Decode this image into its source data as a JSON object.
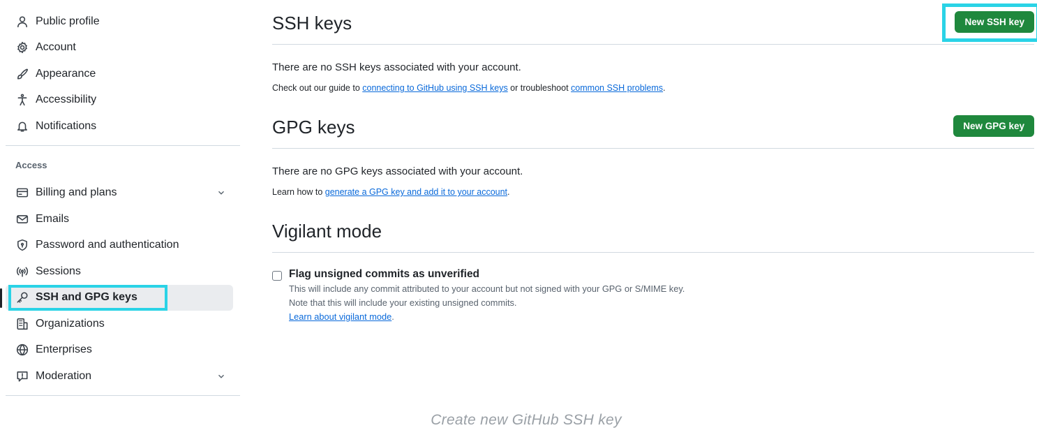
{
  "sidebar": {
    "top_items": [
      {
        "label": "Public profile",
        "icon": "person-icon"
      },
      {
        "label": "Account",
        "icon": "gear-icon"
      },
      {
        "label": "Appearance",
        "icon": "paintbrush-icon"
      },
      {
        "label": "Accessibility",
        "icon": "accessibility-icon"
      },
      {
        "label": "Notifications",
        "icon": "bell-icon"
      }
    ],
    "access_label": "Access",
    "access_items": [
      {
        "label": "Billing and plans",
        "icon": "credit-card-icon"
      },
      {
        "label": "Emails",
        "icon": "mail-icon"
      },
      {
        "label": "Password and authentication",
        "icon": "shield-lock-icon"
      },
      {
        "label": "Sessions",
        "icon": "broadcast-icon"
      },
      {
        "label": "SSH and GPG keys",
        "icon": "key-icon"
      },
      {
        "label": "Organizations",
        "icon": "organization-icon"
      },
      {
        "label": "Enterprises",
        "icon": "globe-icon"
      },
      {
        "label": "Moderation",
        "icon": "report-icon"
      }
    ]
  },
  "ssh": {
    "title": "SSH keys",
    "button": "New SSH key",
    "empty": "There are no SSH keys associated with your account.",
    "help_prefix": "Check out our guide to ",
    "help_link1": "connecting to GitHub using SSH keys",
    "help_middle": " or troubleshoot ",
    "help_link2": "common SSH problems",
    "help_suffix": "."
  },
  "gpg": {
    "title": "GPG keys",
    "button": "New GPG key",
    "empty": "There are no GPG keys associated with your account.",
    "help_prefix": "Learn how to ",
    "help_link": "generate a GPG key and add it to your account",
    "help_suffix": "."
  },
  "vigilant": {
    "title": "Vigilant mode",
    "checkbox_label": "Flag unsigned commits as unverified",
    "checked": false,
    "desc1": "This will include any commit attributed to your account but not signed with your GPG or S/MIME key.",
    "desc2": "Note that this will include your existing unsigned commits.",
    "link": "Learn about vigilant mode",
    "link_suffix": "."
  },
  "caption": "Create new GitHub SSH key",
  "colors": {
    "accent_highlight": "#2ad3e6",
    "primary_button": "#1f883d",
    "link": "#0969da"
  }
}
